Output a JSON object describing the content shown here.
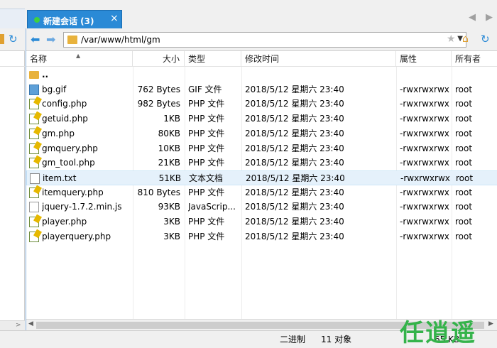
{
  "tab": {
    "title": "新建会话 (3)",
    "close": "×"
  },
  "tab_nav": {
    "prev": "◀",
    "next": "▶"
  },
  "address": {
    "path": "/var/www/html/gm"
  },
  "columns": {
    "name": "名称",
    "size": "大小",
    "type": "类型",
    "modified": "修改时间",
    "attr": "属性",
    "owner": "所有者"
  },
  "files": [
    {
      "name": "..",
      "size": "",
      "type": "",
      "modified": "",
      "attr": "",
      "owner": "",
      "icon": "folder-icon"
    },
    {
      "name": "bg.gif",
      "size": "762 Bytes",
      "type": "GIF 文件",
      "modified": "2018/5/12 星期六 23:40",
      "attr": "-rwxrwxrwx",
      "owner": "root",
      "icon": "image-file-icon"
    },
    {
      "name": "config.php",
      "size": "982 Bytes",
      "type": "PHP 文件",
      "modified": "2018/5/12 星期六 23:40",
      "attr": "-rwxrwxrwx",
      "owner": "root",
      "icon": "php-file-icon"
    },
    {
      "name": "getuid.php",
      "size": "1KB",
      "type": "PHP 文件",
      "modified": "2018/5/12 星期六 23:40",
      "attr": "-rwxrwxrwx",
      "owner": "root",
      "icon": "php-file-icon"
    },
    {
      "name": "gm.php",
      "size": "80KB",
      "type": "PHP 文件",
      "modified": "2018/5/12 星期六 23:40",
      "attr": "-rwxrwxrwx",
      "owner": "root",
      "icon": "php-file-icon"
    },
    {
      "name": "gmquery.php",
      "size": "10KB",
      "type": "PHP 文件",
      "modified": "2018/5/12 星期六 23:40",
      "attr": "-rwxrwxrwx",
      "owner": "root",
      "icon": "php-file-icon"
    },
    {
      "name": "gm_tool.php",
      "size": "21KB",
      "type": "PHP 文件",
      "modified": "2018/5/12 星期六 23:40",
      "attr": "-rwxrwxrwx",
      "owner": "root",
      "icon": "php-file-icon"
    },
    {
      "name": "item.txt",
      "size": "51KB",
      "type": "文本文档",
      "modified": "2018/5/12 星期六 23:40",
      "attr": "-rwxrwxrwx",
      "owner": "root",
      "icon": "text-file-icon"
    },
    {
      "name": "itemquery.php",
      "size": "810 Bytes",
      "type": "PHP 文件",
      "modified": "2018/5/12 星期六 23:40",
      "attr": "-rwxrwxrwx",
      "owner": "root",
      "icon": "php-file-icon"
    },
    {
      "name": "jquery-1.7.2.min.js",
      "size": "93KB",
      "type": "JavaScrip...",
      "modified": "2018/5/12 星期六 23:40",
      "attr": "-rwxrwxrwx",
      "owner": "root",
      "icon": "js-file-icon"
    },
    {
      "name": "player.php",
      "size": "3KB",
      "type": "PHP 文件",
      "modified": "2018/5/12 星期六 23:40",
      "attr": "-rwxrwxrwx",
      "owner": "root",
      "icon": "php-file-icon"
    },
    {
      "name": "playerquery.php",
      "size": "3KB",
      "type": "PHP 文件",
      "modified": "2018/5/12 星期六 23:40",
      "attr": "-rwxrwxrwx",
      "owner": "root",
      "icon": "php-file-icon"
    }
  ],
  "selected_row": 7,
  "status": {
    "mode": "二进制",
    "count": "11 对象",
    "size": "65 KB"
  },
  "watermark": "任逍遥",
  "colors": {
    "accent": "#2a8ad6",
    "selected": "#e5f1fb",
    "watermark": "#34b34a"
  }
}
